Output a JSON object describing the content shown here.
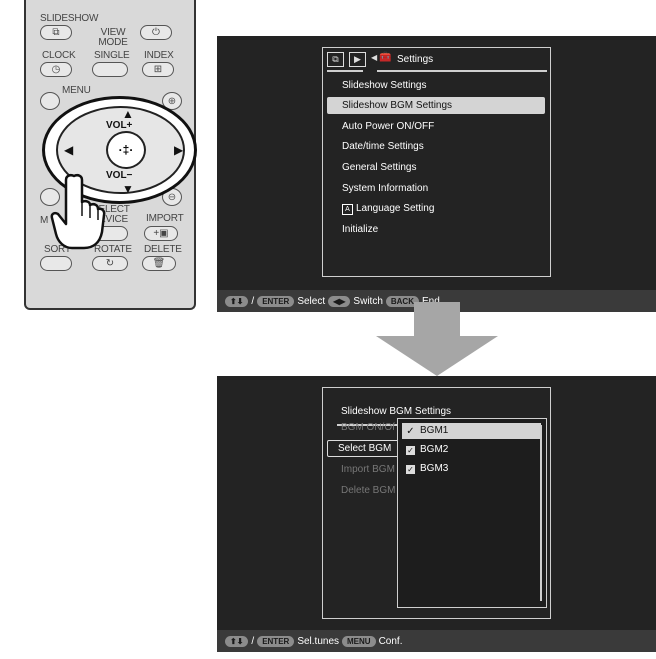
{
  "remote": {
    "slideshow": "SLIDESHOW",
    "view_mode": "VIEW MODE",
    "clock": "CLOCK",
    "single": "SINGLE",
    "index": "INDEX",
    "menu": "MENU",
    "vol_plus": "VOL+",
    "vol_minus": "VOL−",
    "select_device": "SELECT DEVICE",
    "import": "IMPORT",
    "sort": "SORT",
    "rotate": "ROTATE",
    "delete": "DELETE",
    "m_fragment": "M"
  },
  "screen1": {
    "tab_label": "Settings",
    "menu_items": [
      "Slideshow Settings",
      "Slideshow BGM Settings",
      "Auto Power ON/OFF",
      "Date/time Settings",
      "General Settings",
      "System Information",
      "Language Setting",
      "Initialize"
    ],
    "selected_index": 1,
    "status": {
      "arrows_key": "⬆⬇",
      "sep": "/",
      "enter_key": "ENTER",
      "select": "Select",
      "switch_key": "◀▶",
      "switch": "Switch",
      "back_key": "BACK",
      "end": "End"
    }
  },
  "screen2": {
    "title": "Slideshow BGM Settings",
    "left_items": [
      "BGM ON/Of",
      "Select BGM",
      "Import BGM",
      "Delete BGM"
    ],
    "active_left_index": 1,
    "bgm_items": [
      "BGM1",
      "BGM2",
      "BGM3"
    ],
    "selected_bgm_index": 0,
    "status": {
      "arrows_key": "⬆⬇",
      "sep": "/",
      "enter_key": "ENTER",
      "sel_tunes": "Sel.tunes",
      "menu_key": "MENU",
      "conf": "Conf."
    }
  },
  "colors": {
    "screen_bg": "#232323",
    "highlight": "#d4d4d4",
    "arrow": "#a6a6a6"
  }
}
